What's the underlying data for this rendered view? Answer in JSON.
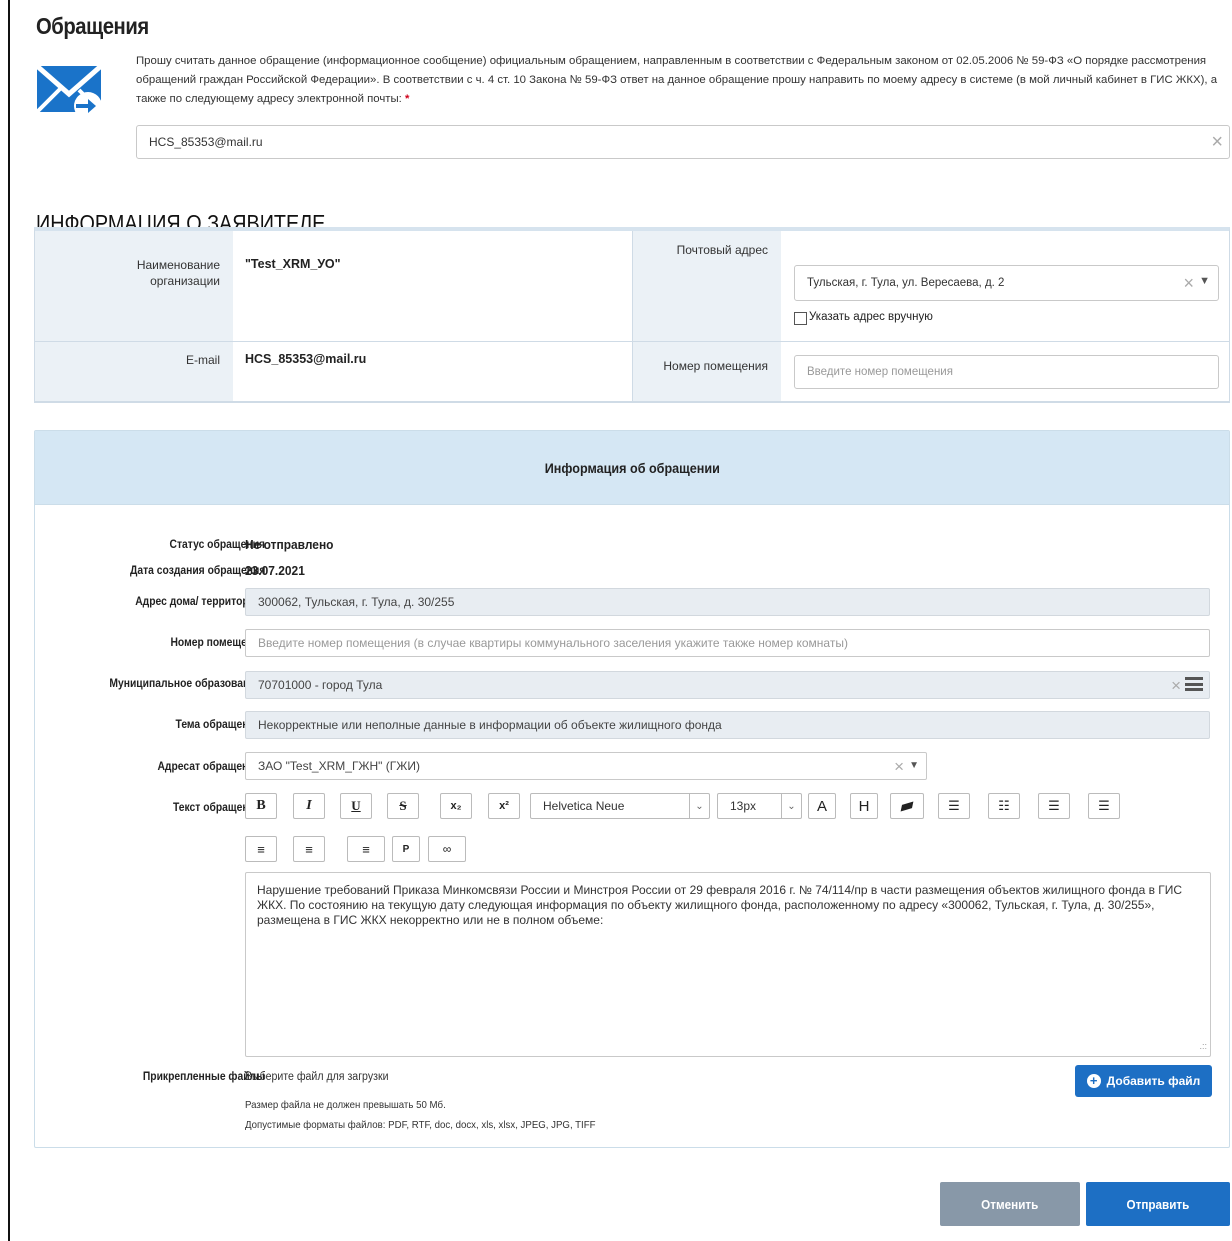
{
  "page": {
    "title": "Обращения"
  },
  "consent": {
    "text": "Прошу считать данное обращение (информационное сообщение) официальным обращением, направленным в соответствии с Федеральным законом от 02.05.2006 № 59-ФЗ «О порядке рассмотрения обращений граждан Российской Федерации». В соответствии с ч. 4 ст. 10 Закона № 59-ФЗ ответ на данное обращение прошу направить по моему адресу в системе (в мой личный кабинет в ГИС ЖКХ), а также по следующему адресу электронной почты:",
    "required_mark": "*",
    "email_value": "HCS_85353@mail.ru"
  },
  "applicant": {
    "section_title": "ИНФОРМАЦИЯ О ЗАЯВИТЕЛЕ",
    "org_label": "Наименование организации",
    "org_value": "\"Test_XRM_УО\"",
    "email_label": "E-mail",
    "email_value": "HCS_85353@mail.ru",
    "postal_label": "Почтовый адрес",
    "postal_value": "Тульская, г. Тула, ул. Вересаева, д. 2",
    "manual_address_label": "Указать адрес вручную",
    "room_label": "Номер помещения",
    "room_placeholder": "Введите номер помещения"
  },
  "appeal": {
    "header": "Информация об обращении",
    "status_label": "Статус обращения",
    "status_value": "Не отправлено",
    "created_label": "Дата создания обращения",
    "created_value": "23.07.2021",
    "address_label": "Адрес дома/ территории",
    "address_value": "300062, Тульская, г. Тула, д. 30/255",
    "room_label": "Номер помещения",
    "room_placeholder": "Введите номер помещения (в случае квартиры коммунального заселения укажите также номер комнаты)",
    "municipal_label": "Муниципальное образование",
    "municipal_value": "70701000 - город Тула",
    "topic_label": "Тема обращения",
    "topic_value": "Некорректные или неполные данные в информации об объекте жилищного фонда",
    "addressee_label": "Адресат обращения",
    "addressee_value": "ЗАО \"Test_XRM_ГЖН\" (ГЖИ)",
    "text_label": "Текст обращения",
    "text_value": "Нарушение требований Приказа Минкомсвязи России и Минстроя России от 29 февраля 2016 г. № 74/114/пр в части размещения объектов жилищного фонда в ГИС ЖКХ. По состоянию на текущую дату следующая информация по объекту жилищного фонда, расположенному по адресу «300062, Тульская, г. Тула, д. 30/255», размещена в ГИС ЖКХ некорректно или не в полном объеме:",
    "files_label": "Прикрепленные файлы",
    "files_hint": "Выберите файл для загрузки",
    "file_size_note": "Размер файла не должен превышать 50 Мб.",
    "file_formats_note": "Допустимые форматы файлов: PDF, RTF, doc, docx, xls, xlsx, JPEG, JPG, TIFF",
    "add_file_button": "Добавить файл"
  },
  "editor": {
    "font": "Helvetica Neue",
    "size": "13px",
    "buttons": {
      "bold": "B",
      "italic": "I",
      "underline": "U",
      "strike": "S",
      "sub": "x₂",
      "sup": "x²",
      "color": "A",
      "highlight": "H",
      "para": "P"
    }
  },
  "actions": {
    "cancel": "Отменить",
    "send": "Отправить"
  },
  "colors": {
    "primary": "#1d6fc4",
    "secondary": "#8898a8",
    "panel_header": "#d5e7f4"
  }
}
